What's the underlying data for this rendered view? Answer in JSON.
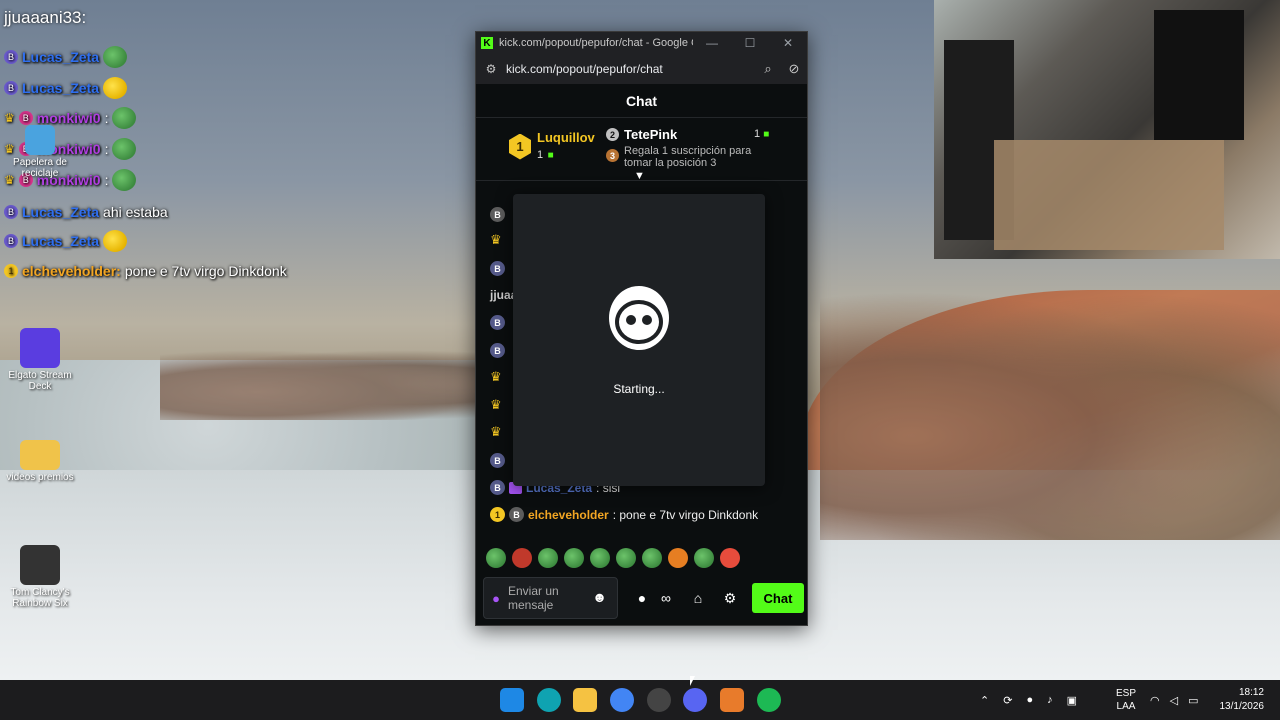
{
  "overlay": {
    "top_user": "jjuaaani33:",
    "lines": [
      {
        "user": "Lucas_Zeta",
        "text": "",
        "emote": "pepe"
      },
      {
        "user": "Lucas_Zeta",
        "text": "",
        "emote": "yellow"
      },
      {
        "user": "monkiwi0",
        "text": ":",
        "emote": "pepe"
      },
      {
        "user": "monkiwi0",
        "text": ":",
        "emote": "pepe"
      },
      {
        "user": "monkiwi0",
        "text": ":",
        "emote": "pepe"
      },
      {
        "user": "Lucas_Zeta",
        "text": "ahi estaba",
        "emote": ""
      },
      {
        "user": "Lucas_Zeta",
        "text": "",
        "emote": "yellow"
      },
      {
        "user": "elcheveholder:",
        "text": "pone e 7tv virgo Dinkdonk",
        "emote": ""
      }
    ]
  },
  "desktop_icons": [
    {
      "label": "Papelera de reciclaje"
    },
    {
      "label": "Elgato Stream Deck"
    },
    {
      "label": "videos premios"
    },
    {
      "label": "Tom Clancy's Rainbow Six"
    }
  ],
  "browser": {
    "title": "kick.com/popout/pepufor/chat - Google C...",
    "url": "kick.com/popout/pepufor/chat",
    "chat_header": "Chat",
    "leaderboard": {
      "first": {
        "rank": "1",
        "name": "Luquillov",
        "count": "1"
      },
      "second": {
        "rank": "2",
        "name": "TetePink",
        "count": "1"
      },
      "third_hint": {
        "rank": "3",
        "text": "Regala 1 suscripción para tomar la posición 3"
      }
    },
    "messages": {
      "partial_user": "jjuaa",
      "lucas_user": "Lucas_Zeta",
      "lucas_text": ": sisi",
      "elche_user": "elcheveholder",
      "elche_text": ": pone e 7tv virgo Dinkdonk"
    },
    "modal_status": "Starting...",
    "input_placeholder": "Enviar un mensaje",
    "chat_button": "Chat"
  },
  "taskbar": {
    "lang_top": "ESP",
    "lang_bottom": "LAA",
    "time": "18:12",
    "date": "13/1/2026"
  },
  "colors": {
    "kick_green": "#53fc18",
    "gold": "#f3c623",
    "user_blue": "#5b7bd5"
  }
}
